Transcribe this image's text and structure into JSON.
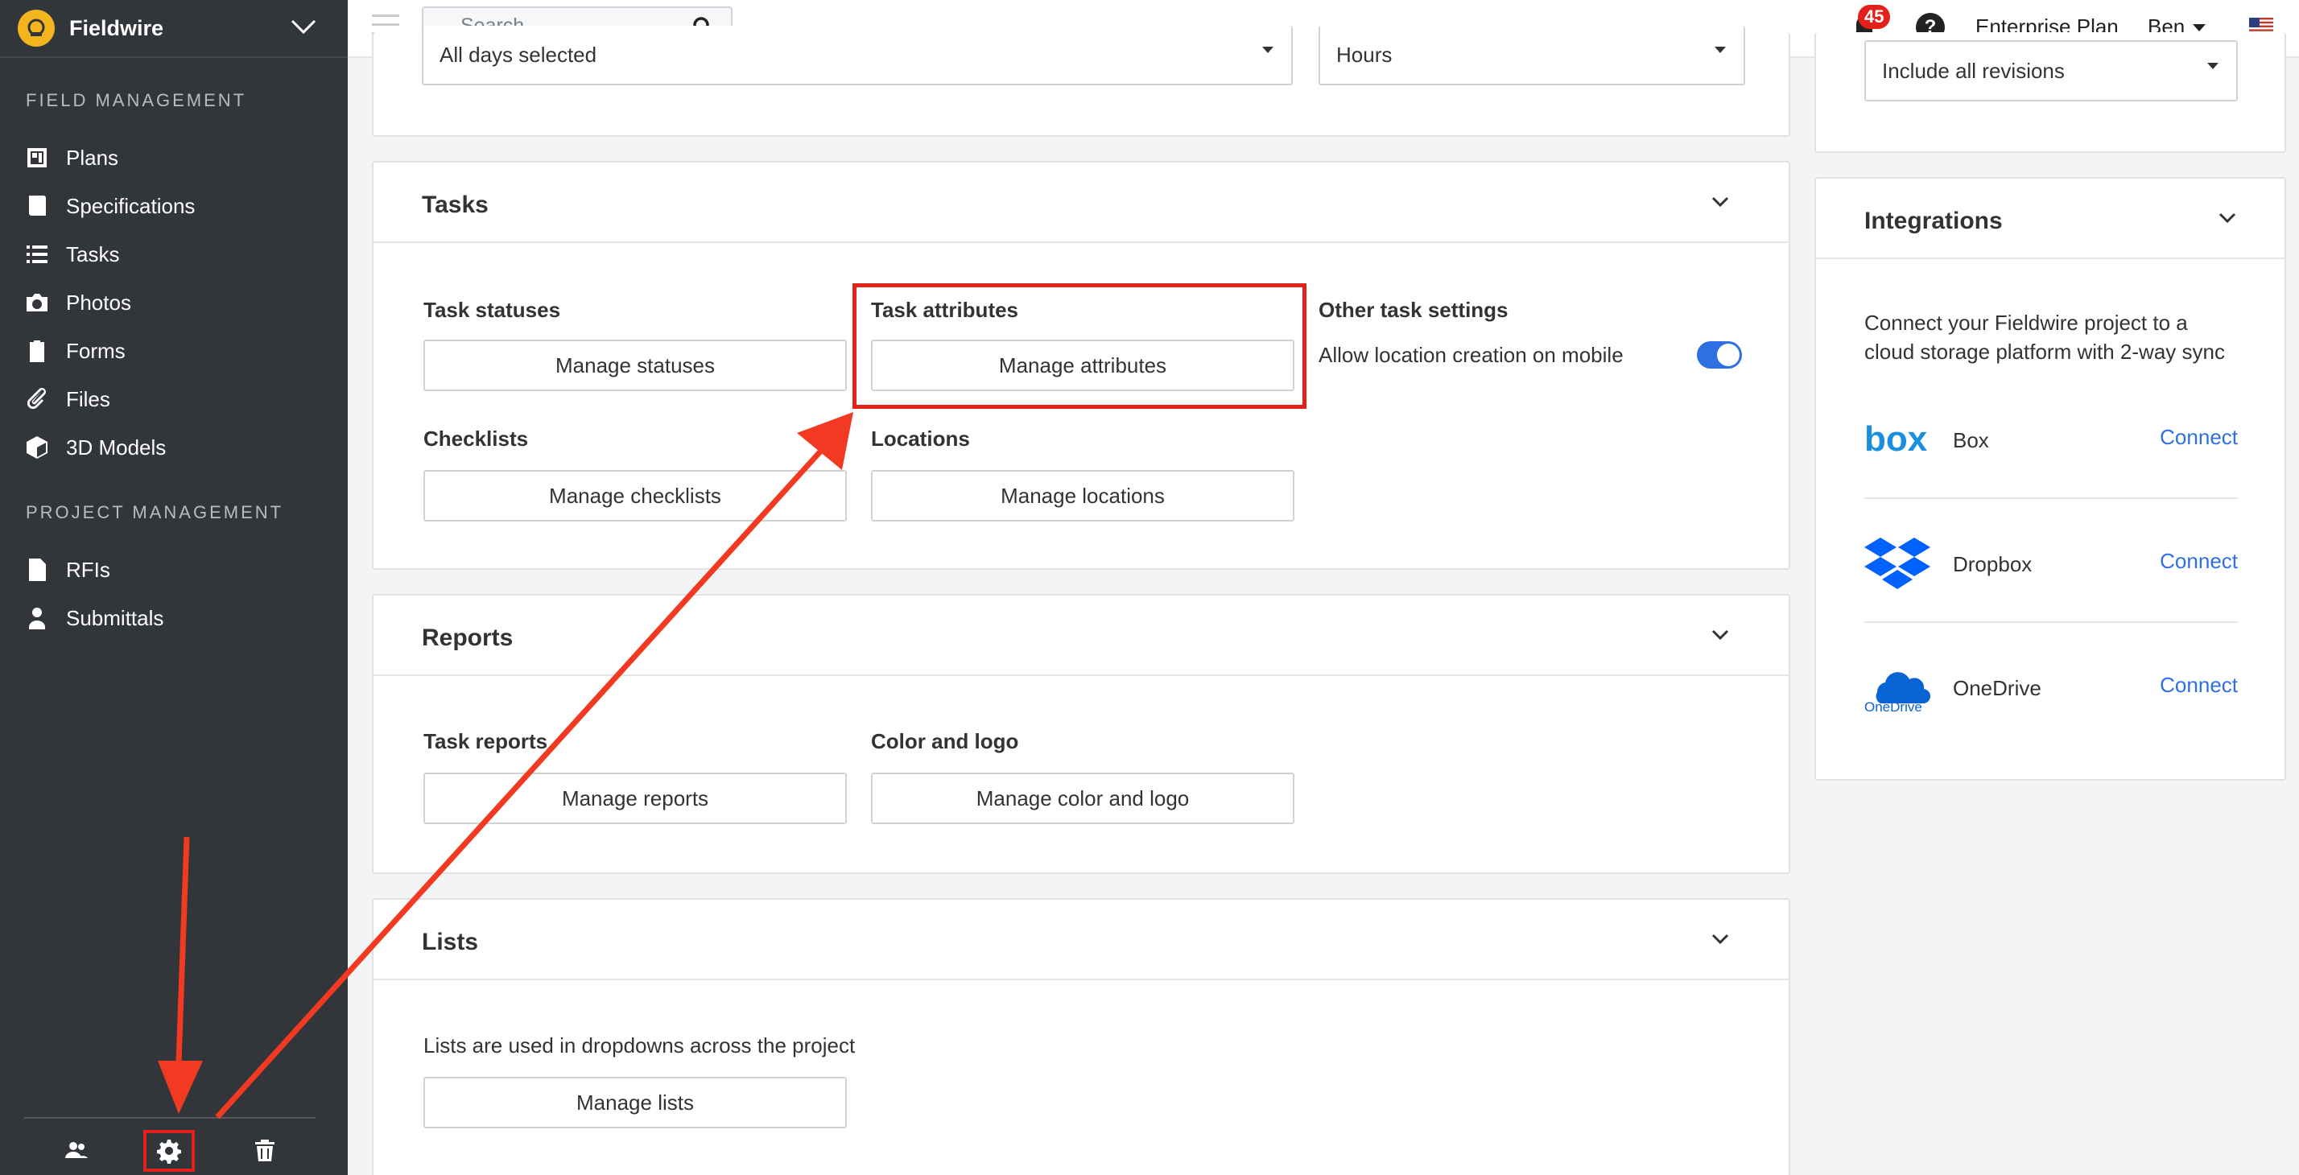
{
  "app": {
    "brand_name": "Fieldwire"
  },
  "sidebar": {
    "field_section_label": "FIELD MANAGEMENT",
    "field_items": [
      {
        "label": "Plans",
        "icon": "plans-icon"
      },
      {
        "label": "Specifications",
        "icon": "specifications-icon"
      },
      {
        "label": "Tasks",
        "icon": "tasks-icon"
      },
      {
        "label": "Photos",
        "icon": "camera-icon"
      },
      {
        "label": "Forms",
        "icon": "clipboard-icon"
      },
      {
        "label": "Files",
        "icon": "paperclip-icon"
      },
      {
        "label": "3D Models",
        "icon": "cube-icon"
      }
    ],
    "project_section_label": "PROJECT MANAGEMENT",
    "project_items": [
      {
        "label": "RFIs",
        "icon": "rfi-document-icon"
      },
      {
        "label": "Submittals",
        "icon": "submittals-icon"
      }
    ],
    "footer_icons": [
      "people-icon",
      "gear-icon",
      "trash-icon"
    ]
  },
  "topbar": {
    "search_placeholder": "Search",
    "notification_count": "45",
    "help_label": "?",
    "plan_label": "Enterprise Plan",
    "user_name": "Ben"
  },
  "top_card": {
    "days_select_value": "All days selected",
    "units_select_value": "Hours"
  },
  "revisions_card": {
    "select_value": "Include all revisions"
  },
  "tasks_card": {
    "title": "Tasks",
    "task_statuses_label": "Task statuses",
    "manage_statuses_button": "Manage statuses",
    "task_attributes_label": "Task attributes",
    "manage_attributes_button": "Manage attributes",
    "other_settings_label": "Other task settings",
    "location_toggle_label": "Allow location creation on mobile",
    "location_toggle_on": true,
    "checklists_label": "Checklists",
    "manage_checklists_button": "Manage checklists",
    "locations_label": "Locations",
    "manage_locations_button": "Manage locations"
  },
  "reports_card": {
    "title": "Reports",
    "task_reports_label": "Task reports",
    "manage_reports_button": "Manage reports",
    "color_logo_label": "Color and logo",
    "manage_color_logo_button": "Manage color and logo"
  },
  "lists_card": {
    "title": "Lists",
    "description": "Lists are used in dropdowns across the project",
    "manage_lists_button": "Manage lists"
  },
  "integrations_card": {
    "title": "Integrations",
    "description_line1": "Connect your Fieldwire project to a",
    "description_line2": "cloud storage platform with 2-way sync",
    "items": [
      {
        "name": "Box",
        "action": "Connect",
        "logo_text": "box"
      },
      {
        "name": "Dropbox",
        "action": "Connect"
      },
      {
        "name": "OneDrive",
        "action": "Connect",
        "logo_text": "OneDrive"
      }
    ]
  },
  "colors": {
    "sidebar_bg": "#323539",
    "accent_blue": "#2f6fe4",
    "annotation_red": "#e3211b",
    "brand_yellow": "#f2b51d"
  }
}
